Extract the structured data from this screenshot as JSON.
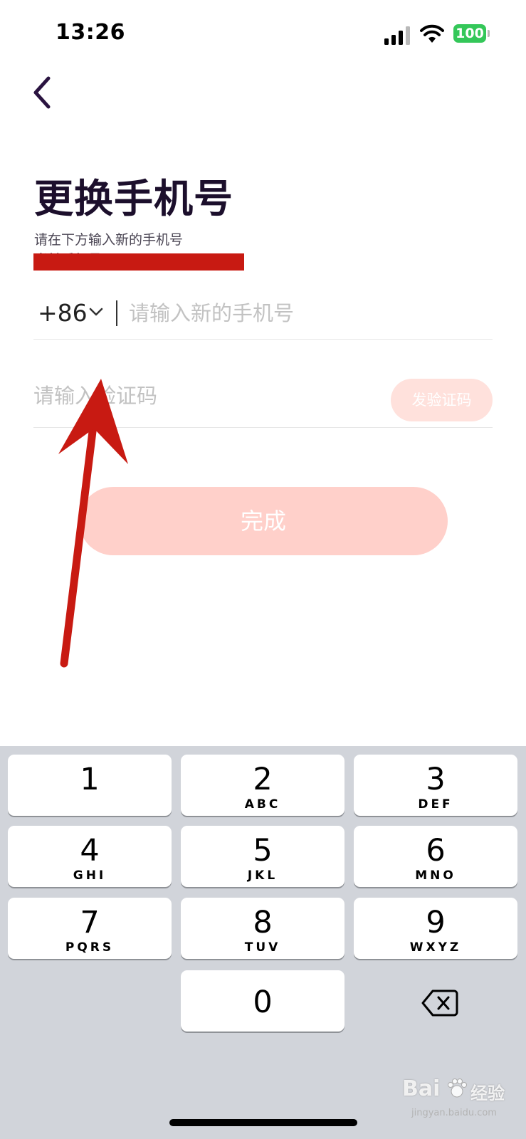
{
  "status_bar": {
    "time": "13:26",
    "battery_level": "100",
    "icons": [
      "signal-icon",
      "wifi-icon",
      "battery-icon"
    ],
    "battery_color": "#34c759"
  },
  "header": {
    "back_icon": "chevron-left-icon",
    "title": "更换手机号",
    "subtitle": "请在下方输入新的手机号",
    "redacted_line": "当前手机号"
  },
  "form": {
    "country_code": "+86",
    "phone_placeholder": "请输入新的手机号",
    "code_placeholder": "请输入验证码",
    "send_code_label": "发验证码",
    "done_label": "完成"
  },
  "colors": {
    "title": "#1c0f2c",
    "primary_disabled": "#ffd0ca",
    "send_code_disabled": "#ffe1dc",
    "redaction": "#c81a12",
    "annotation_arrow": "#c81a12"
  },
  "keyboard": {
    "keys": [
      {
        "digit": "1",
        "letters": ""
      },
      {
        "digit": "2",
        "letters": "ABC"
      },
      {
        "digit": "3",
        "letters": "DEF"
      },
      {
        "digit": "4",
        "letters": "GHI"
      },
      {
        "digit": "5",
        "letters": "JKL"
      },
      {
        "digit": "6",
        "letters": "MNO"
      },
      {
        "digit": "7",
        "letters": "PQRS"
      },
      {
        "digit": "8",
        "letters": "TUV"
      },
      {
        "digit": "9",
        "letters": "WXYZ"
      },
      {
        "digit": "0",
        "letters": ""
      }
    ],
    "delete_icon": "backspace-icon"
  },
  "watermark": {
    "brand": "Bai",
    "brand_suffix": "经验",
    "url": "jingyan.baidu.com"
  }
}
